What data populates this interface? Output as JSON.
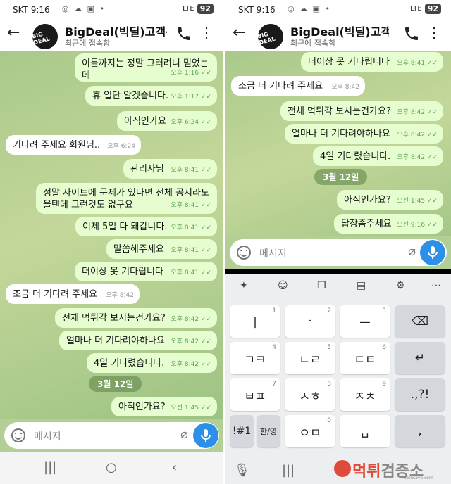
{
  "status": {
    "time": "SKT 9:16",
    "icons": "◎ ☁ ▣ •",
    "signal": "LTE",
    "battery": "92"
  },
  "header": {
    "title": "BigDeal(빅딜)고객센",
    "subtitle": "최근에 접속함",
    "avatar_text": "BIG DEAL"
  },
  "left_chat": [
    {
      "dir": "out",
      "text": "이틀까지는 정말 그러려니 믿었는데",
      "time": "오후 1:16 ✓✓"
    },
    {
      "dir": "out",
      "text": "휴 일단 알겠습니다.",
      "time": "오후 1:17 ✓✓"
    },
    {
      "dir": "out",
      "text": "아직인가요",
      "time": "오후 6:24 ✓✓"
    },
    {
      "dir": "in",
      "text": "기다려 주세요 회원님..",
      "time": "오후 6:24"
    },
    {
      "dir": "out",
      "text": "관리자님",
      "time": "오후 8:41 ✓✓"
    },
    {
      "dir": "out",
      "text": "정말 사이트에 문제가 있다면 전체 공지라도",
      "text2": "올텐데 그런것도 없구요",
      "time": "오후 8:41 ✓✓"
    },
    {
      "dir": "out",
      "text": "이제 5일 다 돼갑니다.",
      "time": "오후 8:41 ✓✓"
    },
    {
      "dir": "out",
      "text": "말씀해주세요",
      "time": "오후 8:41 ✓✓"
    },
    {
      "dir": "out",
      "text": "더이상 못 기다립니다",
      "time": "오후 8:41 ✓✓"
    },
    {
      "dir": "in",
      "text": "조금 더 기다려 주세요",
      "time": "오후 8:42"
    },
    {
      "dir": "out",
      "text": "전체 먹튀각 보시는건가요?",
      "time": "오후 8:42 ✓✓"
    },
    {
      "dir": "out",
      "text": "얼마나 더 기다려야하나요",
      "time": "오후 8:42 ✓✓"
    },
    {
      "dir": "out",
      "text": "4일 기다렸습니다.",
      "time": "오후 8:42 ✓✓"
    },
    {
      "dir": "out",
      "text": "아직인가요?",
      "time": "오전 1:45 ✓✓"
    }
  ],
  "left_date": "3월 12일",
  "right_chat": [
    {
      "dir": "out",
      "text": "더이상 못 기다립니다",
      "time": "오후 8:41 ✓✓"
    },
    {
      "dir": "in",
      "text": "조금 더 기다려 주세요",
      "time": "오후 8:42"
    },
    {
      "dir": "out",
      "text": "전체 먹튀각 보시는건가요?",
      "time": "오후 8:42 ✓✓"
    },
    {
      "dir": "out",
      "text": "얼마나 더 기다려야하나요",
      "time": "오후 8:42 ✓✓"
    },
    {
      "dir": "out",
      "text": "4일 기다렸습니다.",
      "time": "오후 8:42 ✓✓"
    },
    {
      "dir": "out",
      "text": "아직인가요?",
      "time": "오전 1:45 ✓✓"
    },
    {
      "dir": "out",
      "text": "답장좀주세요",
      "time": "오전 9:16 ✓✓"
    }
  ],
  "right_date": "3월 12일",
  "input": {
    "placeholder": "메시지"
  },
  "keyboard": {
    "keys": [
      {
        "label": "ㅣ",
        "num": "1"
      },
      {
        "label": "·",
        "num": "2"
      },
      {
        "label": "ㅡ",
        "num": "3"
      },
      {
        "label": "⌫",
        "num": ""
      },
      {
        "label": "ㄱㅋ",
        "num": "4"
      },
      {
        "label": "ㄴㄹ",
        "num": "5"
      },
      {
        "label": "ㄷㅌ",
        "num": "6"
      },
      {
        "label": "↵",
        "num": ""
      },
      {
        "label": "ㅂㅍ",
        "num": "7"
      },
      {
        "label": "ㅅㅎ",
        "num": "8"
      },
      {
        "label": "ㅈㅊ",
        "num": "9"
      },
      {
        "label": ".,?!",
        "num": ""
      },
      {
        "label": "!#1",
        "num": ""
      },
      {
        "label": "한/영",
        "num": ""
      },
      {
        "label": "ㅇㅁ",
        "num": "0"
      },
      {
        "label": "␣",
        "num": ""
      },
      {
        "label": ",",
        "num": ""
      }
    ]
  },
  "watermark": {
    "main": "먹튀",
    "sub": "검증소",
    "url": "totosave.com"
  }
}
